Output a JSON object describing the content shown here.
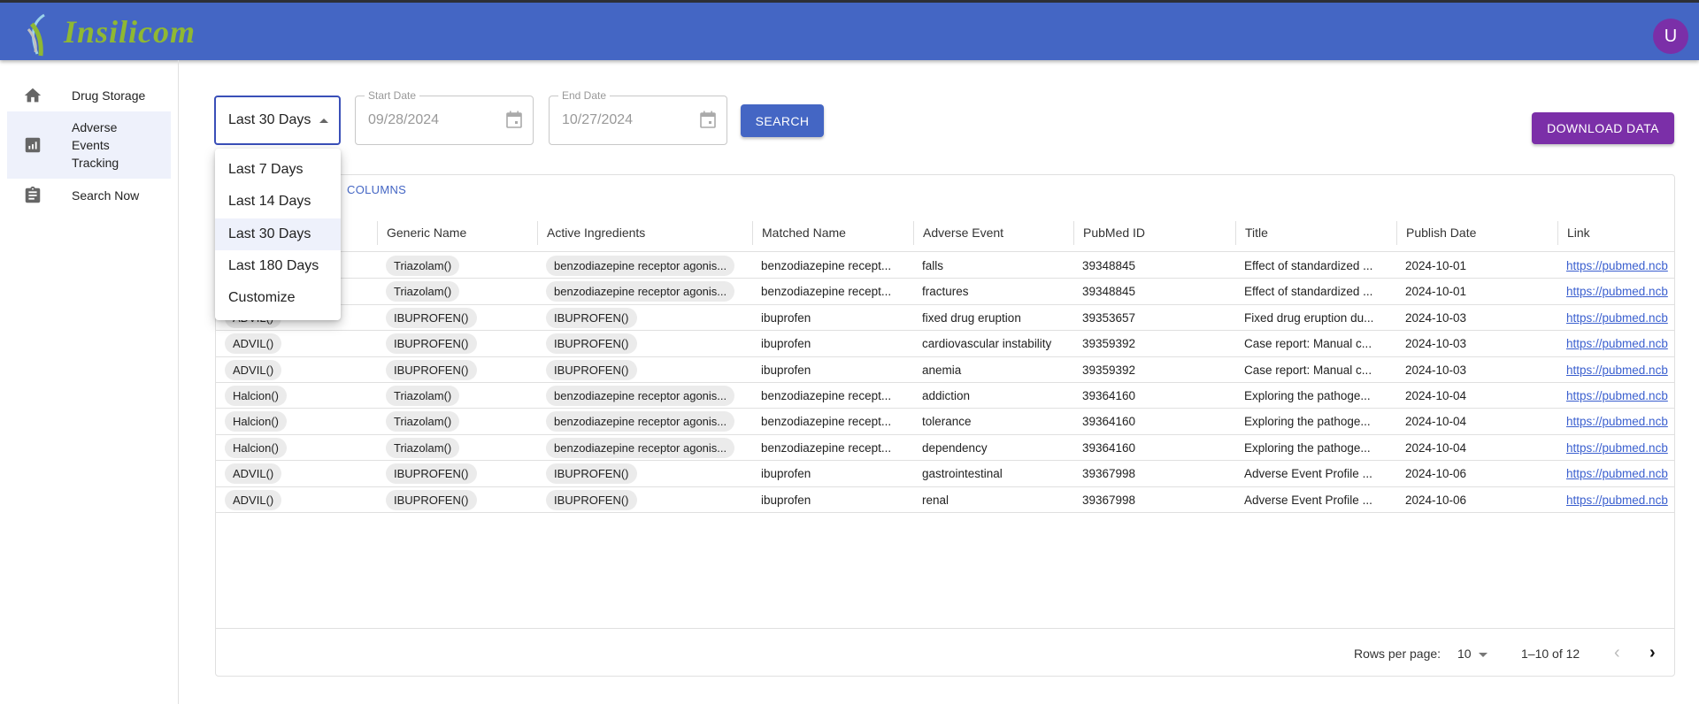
{
  "header": {
    "logo_text": "Insilicom",
    "avatar_initial": "U",
    "brand_color": "#4466c4",
    "avatar_color": "#7b2fa8"
  },
  "sidebar": {
    "items": [
      {
        "label": "Drug Storage",
        "icon": "home-icon"
      },
      {
        "label": "Adverse Events Tracking",
        "icon": "chart-icon",
        "active": true
      },
      {
        "label": "Search Now",
        "icon": "clipboard-icon"
      }
    ]
  },
  "filters": {
    "range_value": "Last 30 Days",
    "range_options": [
      "Last 7 Days",
      "Last 14 Days",
      "Last 30 Days",
      "Last 180 Days",
      "Customize"
    ],
    "start_label": "Start Date",
    "start_value": "09/28/2024",
    "end_label": "End Date",
    "end_value": "10/27/2024",
    "search_label": "SEARCH",
    "download_label": "DOWNLOAD DATA"
  },
  "table": {
    "columns_button": "COLUMNS",
    "headers": [
      "",
      "Generic Name",
      "Active Ingredients",
      "Matched Name",
      "Adverse Event",
      "PubMed ID",
      "Title",
      "Publish Date",
      "Link"
    ],
    "rows": [
      [
        "",
        "Triazolam()",
        "benzodiazepine receptor agonis...",
        "benzodiazepine recept...",
        "falls",
        "39348845",
        "Effect of standardized ...",
        "2024-10-01",
        "https://pubmed.ncb"
      ],
      [
        "",
        "Triazolam()",
        "benzodiazepine receptor agonis...",
        "benzodiazepine recept...",
        "fractures",
        "39348845",
        "Effect of standardized ...",
        "2024-10-01",
        "https://pubmed.ncb"
      ],
      [
        "ADVIL()",
        "IBUPROFEN()",
        "IBUPROFEN()",
        "ibuprofen",
        "fixed drug eruption",
        "39353657",
        "Fixed drug eruption du...",
        "2024-10-03",
        "https://pubmed.ncb"
      ],
      [
        "ADVIL()",
        "IBUPROFEN()",
        "IBUPROFEN()",
        "ibuprofen",
        "cardiovascular instability",
        "39359392",
        "Case report: Manual c...",
        "2024-10-03",
        "https://pubmed.ncb"
      ],
      [
        "ADVIL()",
        "IBUPROFEN()",
        "IBUPROFEN()",
        "ibuprofen",
        "anemia",
        "39359392",
        "Case report: Manual c...",
        "2024-10-03",
        "https://pubmed.ncb"
      ],
      [
        "Halcion()",
        "Triazolam()",
        "benzodiazepine receptor agonis...",
        "benzodiazepine recept...",
        "addiction",
        "39364160",
        "Exploring the pathoge...",
        "2024-10-04",
        "https://pubmed.ncb"
      ],
      [
        "Halcion()",
        "Triazolam()",
        "benzodiazepine receptor agonis...",
        "benzodiazepine recept...",
        "tolerance",
        "39364160",
        "Exploring the pathoge...",
        "2024-10-04",
        "https://pubmed.ncb"
      ],
      [
        "Halcion()",
        "Triazolam()",
        "benzodiazepine receptor agonis...",
        "benzodiazepine recept...",
        "dependency",
        "39364160",
        "Exploring the pathoge...",
        "2024-10-04",
        "https://pubmed.ncb"
      ],
      [
        "ADVIL()",
        "IBUPROFEN()",
        "IBUPROFEN()",
        "ibuprofen",
        "gastrointestinal",
        "39367998",
        "Adverse Event Profile ...",
        "2024-10-06",
        "https://pubmed.ncb"
      ],
      [
        "ADVIL()",
        "IBUPROFEN()",
        "IBUPROFEN()",
        "ibuprofen",
        "renal",
        "39367998",
        "Adverse Event Profile ...",
        "2024-10-06",
        "https://pubmed.ncb"
      ]
    ]
  },
  "pagination": {
    "rows_per_page_label": "Rows per page:",
    "rows_per_page": "10",
    "range": "1–10 of 12"
  }
}
